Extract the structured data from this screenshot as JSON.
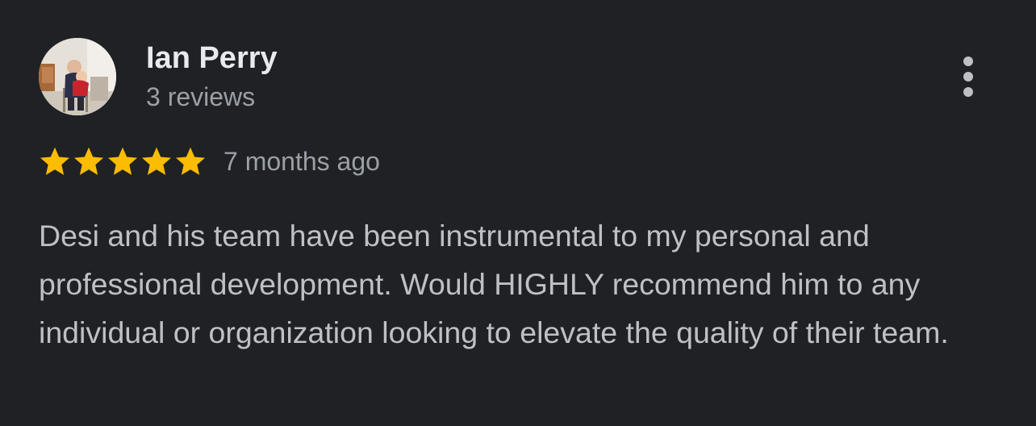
{
  "review": {
    "reviewer_name": "Ian Perry",
    "review_count": "3 reviews",
    "rating": 5,
    "rating_max": 5,
    "time_ago": "7 months ago",
    "text": "Desi and his team have been instrumental to my personal and professional development. Would HIGHLY recommend him to any individual or organization looking to elevate the quality of their team."
  },
  "icons": {
    "avatar": "profile-photo",
    "more": "more-vertical-icon",
    "star": "star-icon"
  },
  "colors": {
    "background": "#202124",
    "name_text": "#e8eaed",
    "secondary_text": "#9aa0a6",
    "body_text": "#bdc1c6",
    "star": "#fbbc04"
  }
}
